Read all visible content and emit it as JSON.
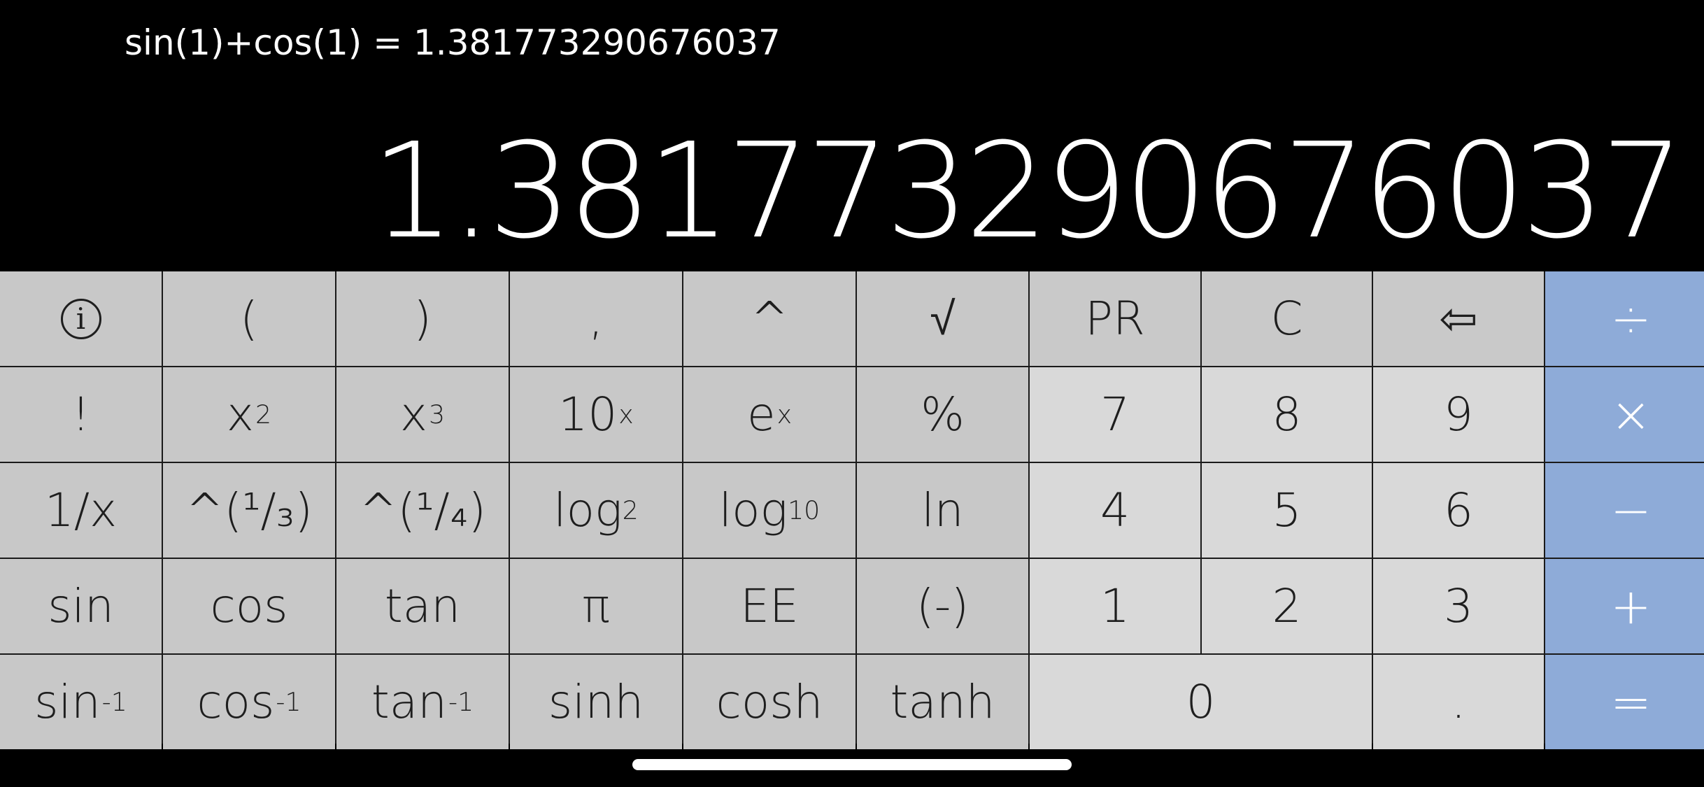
{
  "history": "sin(1)+cos(1) = 1.381773290676037",
  "display": "1.381773290676037",
  "keys": {
    "info": "i",
    "paren_open": "(",
    "paren_close": ")",
    "comma": ",",
    "caret": "^",
    "sqrt": "√",
    "pr": "PR",
    "clear": "C",
    "backspace": "⇦",
    "divide": "÷",
    "factorial": "!",
    "x_squared_base": "x",
    "x_squared_exp": "2",
    "x_cubed_base": "x",
    "x_cubed_exp": "3",
    "ten_pow_base": "10",
    "ten_pow_exp": "x",
    "e_pow_base": "e",
    "e_pow_exp": "x",
    "percent": "%",
    "seven": "7",
    "eight": "8",
    "nine": "9",
    "multiply": "×",
    "reciprocal": "1/x",
    "cube_root": "^(¹/₃)",
    "fourth_root": "^(¹/₄)",
    "log2_base": "log",
    "log2_sub": "2",
    "log10_base": "log",
    "log10_sub": "10",
    "ln": "ln",
    "four": "4",
    "five": "5",
    "six": "6",
    "minus": "−",
    "sin": "sin",
    "cos": "cos",
    "tan": "tan",
    "pi": "π",
    "ee": "EE",
    "negate": "(-)",
    "one": "1",
    "two": "2",
    "three": "3",
    "plus": "+",
    "asin_base": "sin",
    "acos_base": "cos",
    "atan_base": "tan",
    "inverse_exp": "-1",
    "sinh": "sinh",
    "cosh": "cosh",
    "tanh": "tanh",
    "zero": "0",
    "decimal": ".",
    "equals": "="
  },
  "colors": {
    "operator_key": "#8eabd8",
    "scientific_key": "#c8c8c8",
    "number_key": "#d9d9d9",
    "background": "#000000"
  }
}
